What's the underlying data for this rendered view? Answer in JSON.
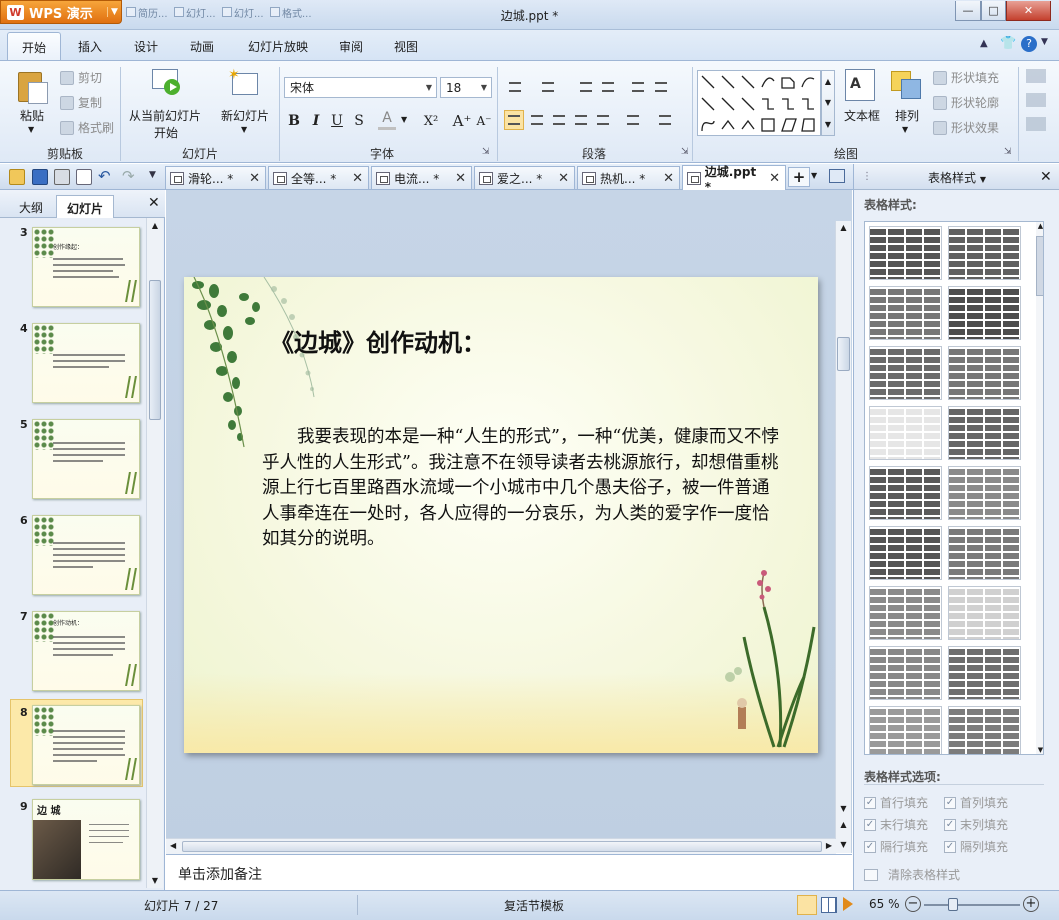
{
  "app": {
    "name": "WPS 演示",
    "title": "边城.ppt *"
  },
  "quick_access": [
    "简历...",
    "幻灯...",
    "幻灯...",
    "格式..."
  ],
  "window_buttons": {
    "minimize": "—",
    "maximize": "□",
    "close": "✕"
  },
  "ribbon_tabs": [
    "开始",
    "插入",
    "设计",
    "动画",
    "幻灯片放映",
    "审阅",
    "视图"
  ],
  "ribbon": {
    "clipboard": {
      "paste": "粘贴",
      "cut": "剪切",
      "copy": "复制",
      "format_painter": "格式刷",
      "label": "剪贴板"
    },
    "slides": {
      "from_current": "从当前幻灯片",
      "start": "开始",
      "new_slide": "新幻灯片",
      "label": "幻灯片"
    },
    "font": {
      "name": "宋体",
      "size": "18",
      "label": "字体",
      "bold": "B",
      "italic": "I",
      "underline": "U",
      "strike": "S",
      "color": "A",
      "superscript": "X²",
      "grow": "A⁺",
      "shrink": "A⁻"
    },
    "paragraph": {
      "label": "段落"
    },
    "drawing": {
      "label": "绘图",
      "textbox": "文本框",
      "arrange": "排列",
      "shape_fill": "形状填充",
      "shape_outline": "形状轮廓",
      "shape_effect": "形状效果"
    }
  },
  "doc_tabs": [
    {
      "label": "滑轮... *",
      "active": false
    },
    {
      "label": "全等... *",
      "active": false
    },
    {
      "label": "电流... *",
      "active": false
    },
    {
      "label": "爱之... *",
      "active": false
    },
    {
      "label": "热机... *",
      "active": false
    },
    {
      "label": "边城.ppt *",
      "active": true
    }
  ],
  "left_pane": {
    "tabs": [
      "大纲",
      "幻灯片"
    ],
    "thumbnails": [
      {
        "num": "3",
        "heading": "创作缘起："
      },
      {
        "num": "4",
        "heading": ""
      },
      {
        "num": "5",
        "heading": ""
      },
      {
        "num": "6",
        "heading": ""
      },
      {
        "num": "7",
        "heading": "创作动机："
      },
      {
        "num": "8",
        "heading": ""
      },
      {
        "num": "9",
        "heading": "边 城"
      }
    ],
    "selected": "8"
  },
  "slide": {
    "title": "《边城》创作动机：",
    "body": "我要表现的本是一种“人生的形式”，一种“优美，健康而又不悖乎人性的人生形式”。我注意不在领导读者去桃源旅行，却想借重桃源上行七百里路酉水流域一个小城市中几个愚夫俗子，被一件普通人事牵连在一处时，各人应得的一分哀乐，为人类的爱字作一度恰如其分的说明。"
  },
  "notes_placeholder": "单击添加备注",
  "right_pane": {
    "header": "表格样式",
    "gallery_label": "表格样式:",
    "options_label": "表格样式选项:",
    "options": [
      {
        "label": "首行填充",
        "checked": true
      },
      {
        "label": "首列填充",
        "checked": true
      },
      {
        "label": "末行填充",
        "checked": true
      },
      {
        "label": "末列填充",
        "checked": true
      },
      {
        "label": "隔行填充",
        "checked": true
      },
      {
        "label": "隔列填充",
        "checked": true
      }
    ],
    "clear": "清除表格样式",
    "styles": [
      "#555555",
      "#606060",
      "#777777",
      "#4d4d4d",
      "#6b6b6b",
      "#777777",
      "#e6e6e6",
      "#666666",
      "#5a5a5a",
      "#8a8a8a",
      "#555555",
      "#7a7a7a",
      "#8a8a8a",
      "#d0d0d0",
      "#888888",
      "#6e6e6e",
      "#9a9a9a",
      "#7c7c7c"
    ]
  },
  "status": {
    "slide_info": "幻灯片 7 / 27",
    "template": "复活节模板",
    "zoom": "65 %"
  },
  "colors": {
    "accent": "#f39a2e",
    "frame": "#9fb6d5"
  }
}
